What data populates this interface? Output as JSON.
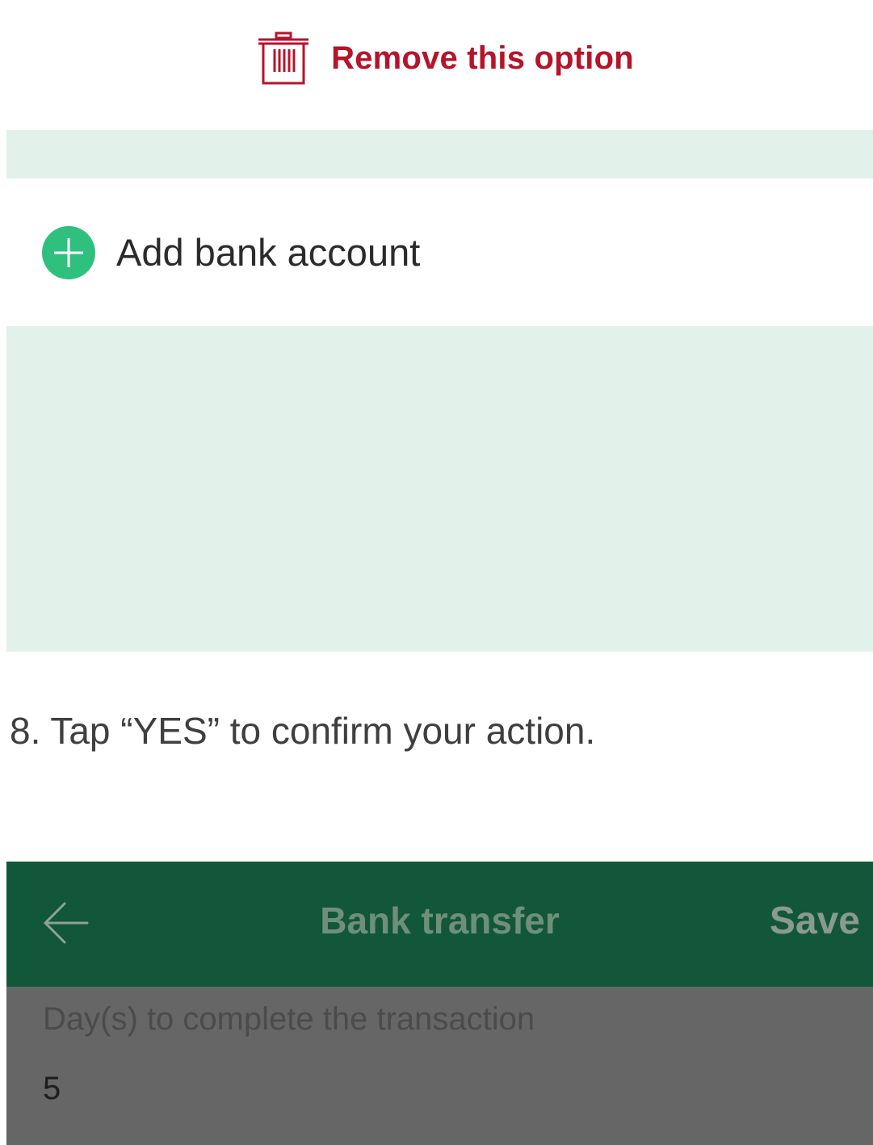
{
  "remove_option": {
    "label": "Remove this option",
    "icon": "trash-icon",
    "color": "#b5142b"
  },
  "add_bank": {
    "label": "Add bank account",
    "icon": "plus-circle-icon",
    "color": "#2fc07e"
  },
  "instruction": {
    "text": "8. Tap “YES” to confirm your action."
  },
  "app_bar": {
    "back_icon": "arrow-left-icon",
    "title": "Bank transfer",
    "save_label": "Save",
    "background": "#12573a"
  },
  "form": {
    "days_label": "Day(s) to complete the transaction",
    "days_value": "5"
  }
}
